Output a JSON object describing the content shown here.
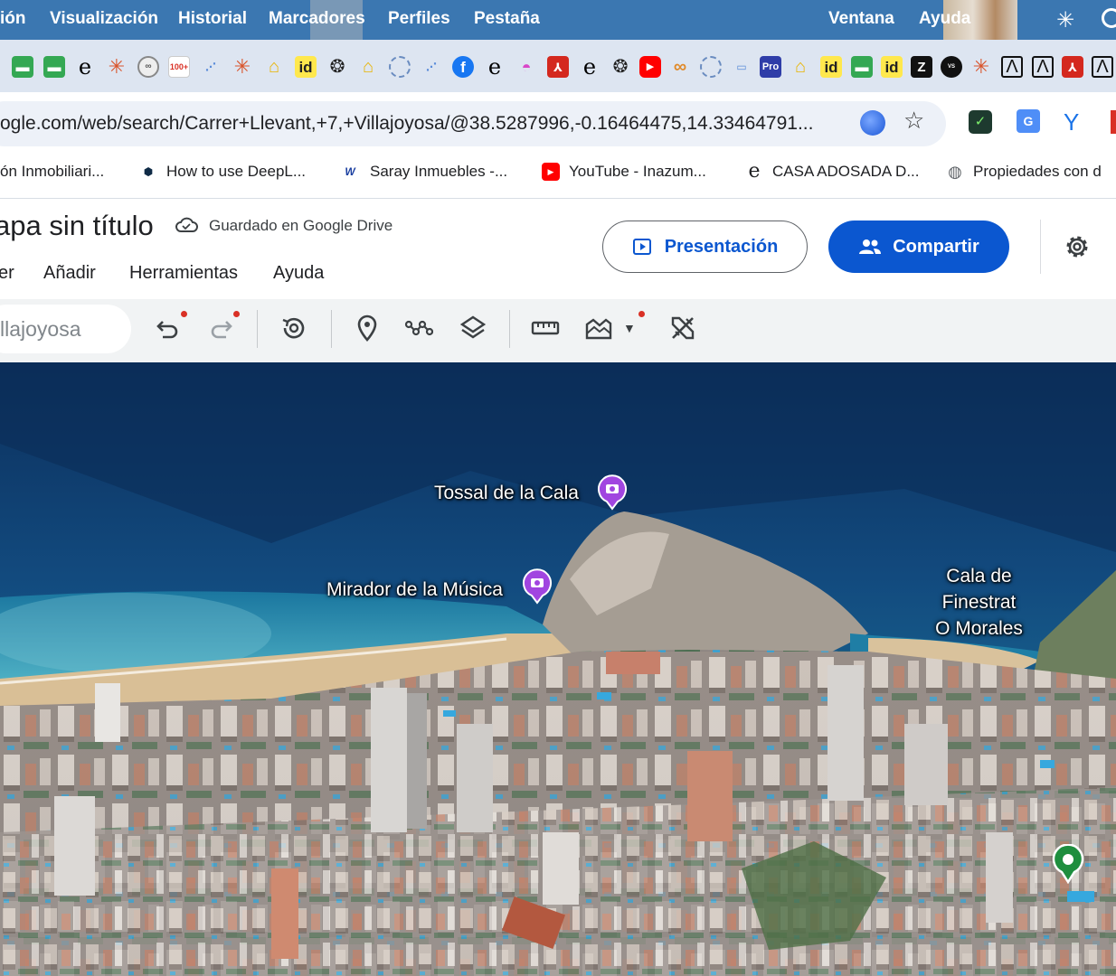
{
  "menubar": {
    "items": [
      "ión",
      "Visualización",
      "Historial",
      "Marcadores",
      "Perfiles",
      "Pestaña",
      "Ventana",
      "Ayuda"
    ]
  },
  "tabs": {
    "icons": [
      "green-tab-icon",
      "green-tab-icon",
      "e-icon",
      "asterisk-icon",
      "infinity-ring-icon",
      "gmail-100-icon",
      "tab-icon",
      "asterisk-icon",
      "house-icon",
      "id-icon",
      "openai-icon",
      "house-icon",
      "spinner-icon",
      "tab-icon",
      "facebook-icon",
      "e-icon",
      "pink-icon",
      "pdf-icon",
      "e-icon",
      "openai-icon",
      "youtube-icon",
      "infinity-icon",
      "spinner-icon",
      "tab-icon",
      "pro-icon",
      "house-icon",
      "id-icon",
      "green-tab-icon",
      "id-icon",
      "z-icon",
      "vs-icon",
      "asterisk-icon",
      "a-icon",
      "a-icon",
      "pdf-icon",
      "a-icon"
    ]
  },
  "address": {
    "url": "ogle.com/web/search/Carrer+Llevant,+7,+Villajoyosa/@38.5287996,-0.16464475,14.33464791..."
  },
  "bookmarks": [
    {
      "label": "ón Inmobiliari...",
      "icon": "none"
    },
    {
      "label": "How to use DeepL...",
      "icon": "deepl-icon"
    },
    {
      "label": "Saray Inmuebles -...",
      "icon": "saray-icon"
    },
    {
      "label": "YouTube - Inazum...",
      "icon": "youtube-icon"
    },
    {
      "label": "CASA ADOSADA D...",
      "icon": "e-icon"
    },
    {
      "label": "Propiedades con d",
      "icon": "globe-icon"
    }
  ],
  "header": {
    "title": "apa sin título",
    "save_status": "Guardado en Google Drive",
    "menus": [
      "er",
      "Añadir",
      "Herramientas",
      "Ayuda"
    ],
    "present_label": "Presentación",
    "share_label": "Compartir"
  },
  "toolbar": {
    "search_value": "llajoyosa"
  },
  "map": {
    "labels": {
      "tossal": "Tossal de la Cala",
      "mirador": "Mirador de la Música",
      "cala_1": "Cala de",
      "cala_2": "Finestrat",
      "cala_3": "O Morales"
    }
  },
  "colors": {
    "menubar": "#3b77b1",
    "accent": "#0b57d0",
    "tabstrip": "#dde5f1"
  }
}
